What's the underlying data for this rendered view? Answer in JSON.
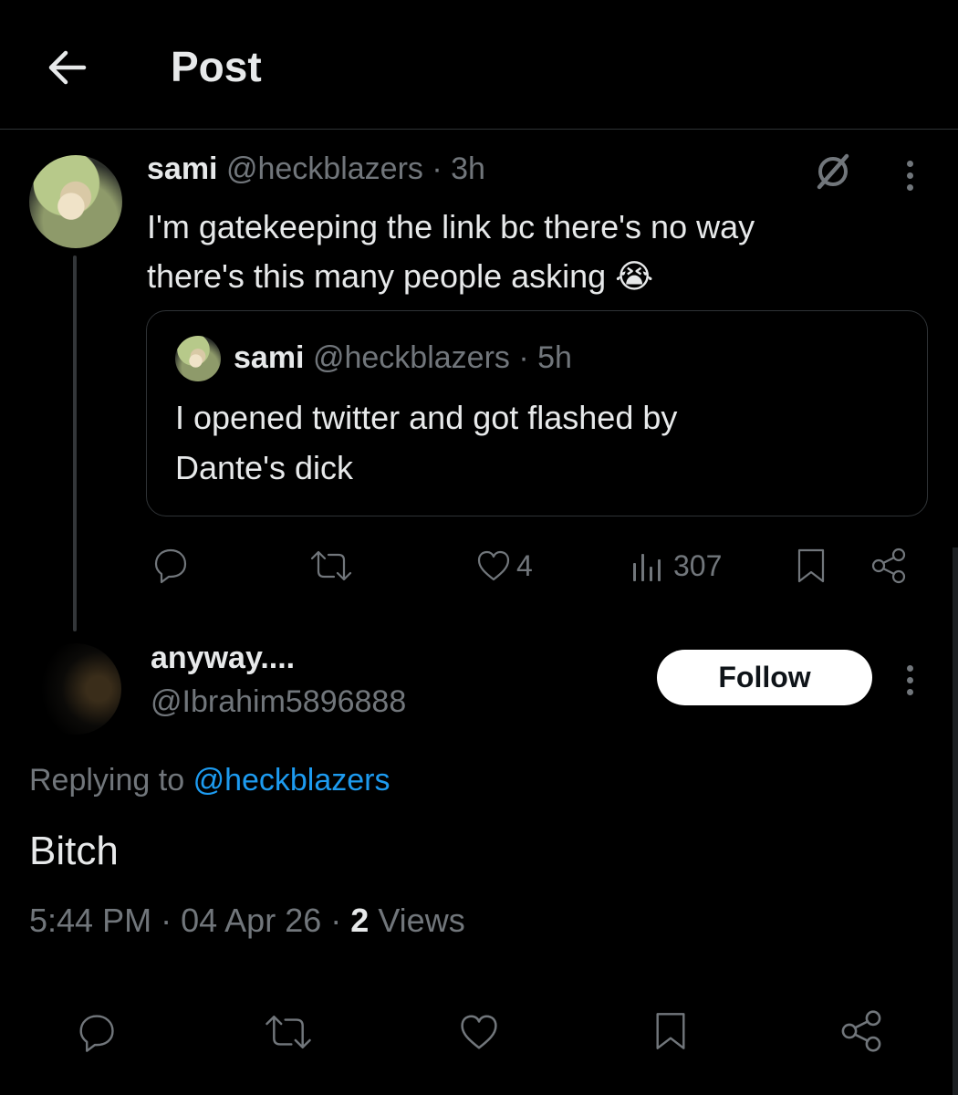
{
  "header": {
    "title": "Post"
  },
  "main_post": {
    "display_name": "sami",
    "handle": "@heckblazers",
    "separator": "·",
    "time": "3h",
    "text_line1": "I'm gatekeeping the link bc there's no way",
    "text_line2": "there's this many people asking",
    "emoji": "😭",
    "quote": {
      "display_name": "sami",
      "handle": "@heckblazers",
      "separator": "·",
      "time": "5h",
      "text_line1": "I opened twitter and got flashed by",
      "text_line2": "Dante's dick"
    },
    "actions": {
      "likes": "4",
      "views": "307"
    }
  },
  "reply": {
    "display_name": "anyway....",
    "handle": "@Ibrahim5896888",
    "follow_label": "Follow",
    "replying_to_prefix": "Replying to",
    "replying_to_handle": "@heckblazers",
    "text": "Bitch",
    "time": "5:44 PM",
    "separator": "·",
    "date": "04 Apr 26",
    "views_count": "2",
    "views_label": "Views"
  },
  "colors": {
    "background": "#000000",
    "text": "#e7e9ea",
    "secondary": "#71767b",
    "link": "#1d9bf0",
    "divider": "#2f3336"
  },
  "icons": {
    "back": "arrow-left-icon",
    "grok": "grok-icon",
    "more": "more-vertical-icon",
    "reply": "reply-icon",
    "repost": "repost-icon",
    "like": "heart-icon",
    "views": "views-icon",
    "bookmark": "bookmark-icon",
    "share": "share-icon"
  }
}
